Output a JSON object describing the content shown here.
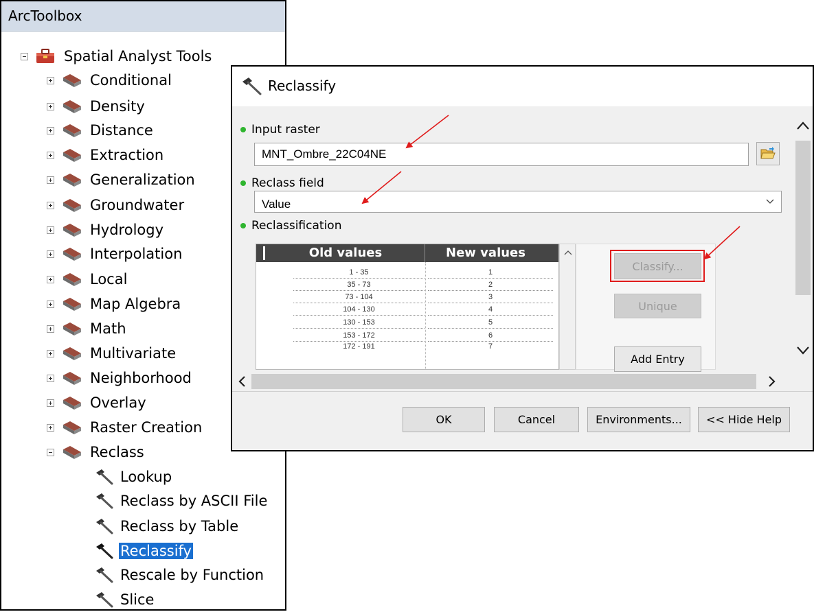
{
  "toolbox": {
    "title": "ArcToolbox",
    "root": {
      "label": "Spatial Analyst Tools",
      "expanded": true
    },
    "toolsets": [
      {
        "label": "Conditional",
        "expanded": false
      },
      {
        "label": "Density",
        "expanded": false
      },
      {
        "label": "Distance",
        "expanded": false
      },
      {
        "label": "Extraction",
        "expanded": false
      },
      {
        "label": "Generalization",
        "expanded": false
      },
      {
        "label": "Groundwater",
        "expanded": false
      },
      {
        "label": "Hydrology",
        "expanded": false
      },
      {
        "label": "Interpolation",
        "expanded": false
      },
      {
        "label": "Local",
        "expanded": false
      },
      {
        "label": "Map Algebra",
        "expanded": false
      },
      {
        "label": "Math",
        "expanded": false
      },
      {
        "label": "Multivariate",
        "expanded": false
      },
      {
        "label": "Neighborhood",
        "expanded": false
      },
      {
        "label": "Overlay",
        "expanded": false
      },
      {
        "label": "Raster Creation",
        "expanded": false
      },
      {
        "label": "Reclass",
        "expanded": true
      }
    ],
    "reclass_tools": [
      {
        "label": "Lookup",
        "selected": false
      },
      {
        "label": "Reclass by ASCII File",
        "selected": false
      },
      {
        "label": "Reclass by Table",
        "selected": false
      },
      {
        "label": "Reclassify",
        "selected": true
      },
      {
        "label": "Rescale by Function",
        "selected": false
      },
      {
        "label": "Slice",
        "selected": false
      }
    ]
  },
  "dialog": {
    "title": "Reclassify",
    "input_raster": {
      "label": "Input raster",
      "value": "MNT_Ombre_22C04NE"
    },
    "reclass_field": {
      "label": "Reclass field",
      "value": "Value"
    },
    "reclassification": {
      "label": "Reclassification",
      "columns": [
        "Old values",
        "New values"
      ],
      "rows": [
        {
          "old": "1 - 35",
          "new": "1"
        },
        {
          "old": "35 - 73",
          "new": "2"
        },
        {
          "old": "73 - 104",
          "new": "3"
        },
        {
          "old": "104 - 130",
          "new": "4"
        },
        {
          "old": "130 - 153",
          "new": "5"
        },
        {
          "old": "153 - 172",
          "new": "6"
        },
        {
          "old": "172 - 191",
          "new": "7"
        }
      ],
      "buttons": {
        "classify": "Classify...",
        "unique": "Unique",
        "add_entry": "Add Entry"
      }
    },
    "footer": {
      "ok": "OK",
      "cancel": "Cancel",
      "environments": "Environments...",
      "hide_help": "<< Hide Help"
    }
  },
  "colors": {
    "selection": "#1a6fd0",
    "required_dot": "#2fb52f",
    "annotation_arrow": "#e01b1b",
    "table_header": "#454545"
  }
}
